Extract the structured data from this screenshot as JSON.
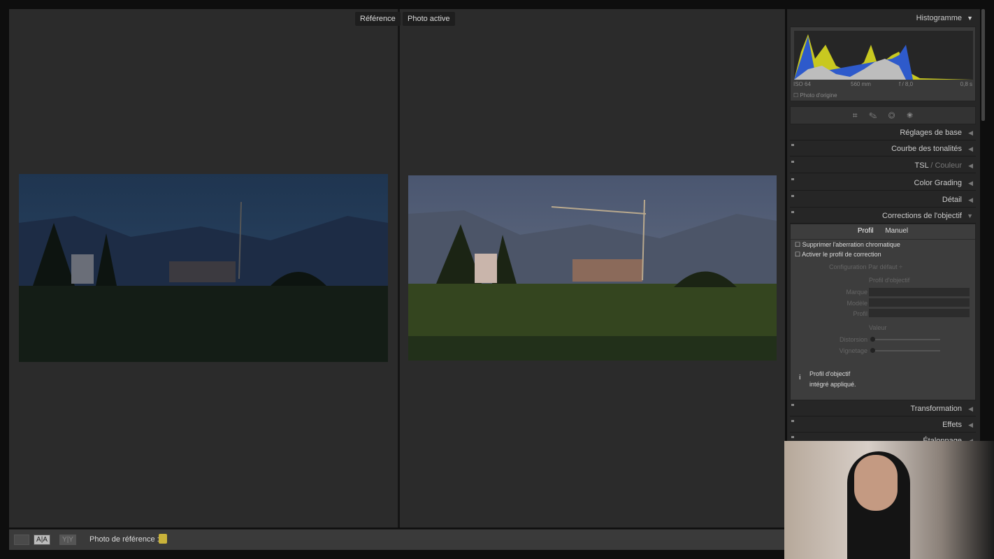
{
  "compare": {
    "reference_label": "Référence",
    "active_label": "Photo active"
  },
  "toolbar": {
    "view_icon": "loupe-icon",
    "ab_label": "A|A",
    "yy_label": "Y|Y",
    "reference_photo_label": "Photo de référence :",
    "lock_icon": "lock-icon"
  },
  "histogram": {
    "title": "Histogramme",
    "iso": "ISO 64",
    "focal": "560 mm",
    "aperture": "f / 8,0",
    "shutter": "0,8 s",
    "original_photo": "Photo d'origine"
  },
  "tools": [
    "crop-icon",
    "healing-icon",
    "redeye-icon",
    "mask-icon"
  ],
  "panels": {
    "basic": "Réglages de base",
    "tone_curve": "Courbe des tonalités",
    "hsl": "TSL",
    "hsl_sep": " / ",
    "color": "Couleur",
    "color_grading": "Color Grading",
    "detail": "Détail",
    "lens": "Corrections de l'objectif",
    "transformation": "Transformation",
    "effects": "Effets",
    "calibration": "Étalonnage"
  },
  "lens": {
    "tab_profile": "Profil",
    "tab_manual": "Manuel",
    "remove_ca": "Supprimer l'aberration chromatique",
    "enable_profile": "Activer le profil de correction",
    "setup_label": "Configuration",
    "setup_value": "Par défaut ÷",
    "lens_profile": "Profil d'objectif",
    "make": "Marque",
    "model": "Modèle",
    "profile": "Profil",
    "amount": "Valeur",
    "distortion": "Distorsion",
    "vignetting": "Vignetage",
    "info_line1": "Profil d'objectif",
    "info_line2": "intégré appliqué.",
    "distortion_value": 0,
    "vignetting_value": 0
  },
  "colors": {
    "bg": "#2b2b2b",
    "panel": "#262626",
    "lock": "#c9b23a"
  }
}
